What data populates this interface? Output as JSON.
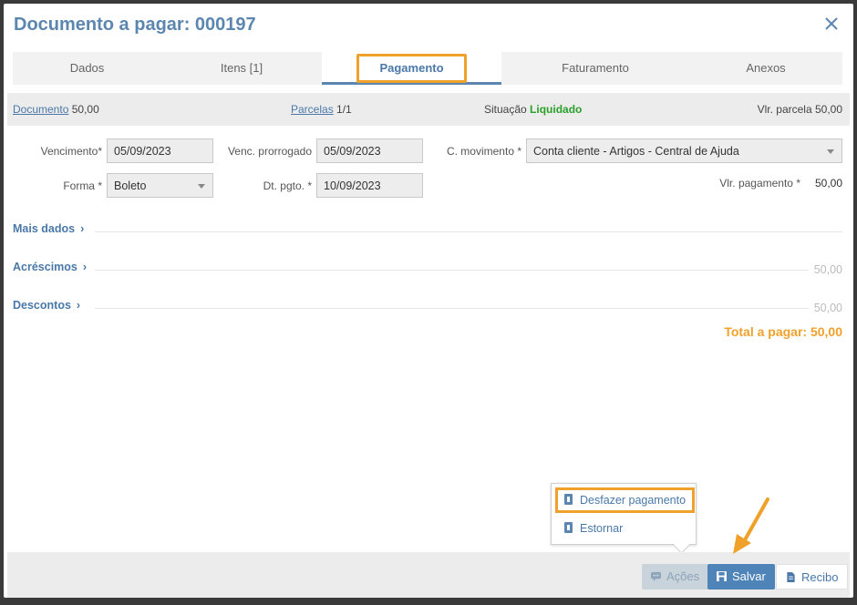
{
  "dialog": {
    "title": "Documento a pagar: 000197"
  },
  "tabs": [
    {
      "label": "Dados"
    },
    {
      "label": "Itens [1]"
    },
    {
      "label": "Pagamento"
    },
    {
      "label": "Faturamento"
    },
    {
      "label": "Anexos"
    }
  ],
  "infobar": {
    "documento_label": "Documento",
    "documento_value": "50,00",
    "parcelas_label": "Parcelas",
    "parcelas_value": "1/1",
    "situacao_label": "Situação",
    "situacao_value": "Liquidado",
    "vlr_parcela_label": "Vlr. parcela",
    "vlr_parcela_value": "50,00"
  },
  "form": {
    "vencimento_label": "Vencimento*",
    "vencimento_value": "05/09/2023",
    "venc_prorrogado_label": "Venc. prorrogado",
    "venc_prorrogado_value": "05/09/2023",
    "c_movimento_label": "C. movimento *",
    "c_movimento_value": "Conta cliente - Artigos - Central de Ajuda",
    "forma_label": "Forma *",
    "forma_value": "Boleto",
    "dt_pgto_label": "Dt. pgto. *",
    "dt_pgto_value": "10/09/2023",
    "vlr_pagamento_label": "Vlr. pagamento *",
    "vlr_pagamento_value": "50,00"
  },
  "sections": {
    "mais_dados": {
      "label": "Mais dados"
    },
    "acrescimos": {
      "label": "Acréscimos",
      "value": "50,00"
    },
    "descontos": {
      "label": "Descontos",
      "value": "50,00"
    }
  },
  "total": "Total a pagar: 50,00",
  "popup_menu": {
    "desfazer": "Desfazer pagamento",
    "estornar": "Estornar"
  },
  "footer": {
    "acoes": "Ações",
    "salvar": "Salvar",
    "recibo": "Recibo"
  },
  "colors": {
    "accent": "#5b86b0",
    "highlight": "#f0a12a",
    "status_green": "#2aa02a"
  }
}
